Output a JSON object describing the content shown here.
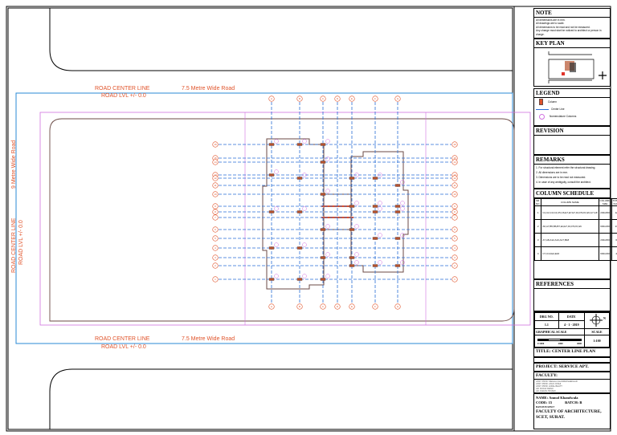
{
  "road": {
    "top_center_line": "ROAD CENTER LINE",
    "top_road_name": "7.5 Metre Wide Road",
    "top_level": "ROAD LVL +/- 0.0",
    "bottom_center_line": "ROAD CENTER LINE",
    "bottom_road_name": "7.5 Metre Wide Road",
    "bottom_level": "ROAD LVL +/- 0.0",
    "left_road_name": "9 Metre Wide Road",
    "left_center_line": "ROAD CENTER LINE",
    "left_level": "ROAD LVL +/- 0.0"
  },
  "grid": {
    "vertical_labels": [
      "A",
      "B",
      "C",
      "D",
      "E",
      "F",
      "G"
    ],
    "horizontal_labels": [
      "16",
      "15",
      "14",
      "13",
      "12",
      "11",
      "10",
      "9",
      "8",
      "7",
      "6",
      "5",
      "4",
      "3",
      "2",
      "1"
    ]
  },
  "colors": {
    "grid": "#2a6fd6",
    "bubble": "#e0532a",
    "column": "#b5522e",
    "wall": "#6b4a45",
    "magenta": "#d070e0",
    "road_line": "#2a8ad6"
  },
  "title_block": {
    "note_header": "NOTE",
    "notes": [
      "All dimensions are in mm.",
      "All drawings are to scale.",
      "All dimensions to be read and not be measured.",
      "Any change must start be noticed to architect or person in charge."
    ],
    "key_plan_header": "KEY PLAN",
    "legend_header": "LEGEND",
    "legend": [
      {
        "icon": "column-icon",
        "label": "Column"
      },
      {
        "icon": "center-line-icon",
        "label": "Center Line"
      },
      {
        "icon": "nomenclature-icon",
        "label": "Nomenclature Columns"
      }
    ],
    "revision_header": "REVISION",
    "remarks_header": "REMARKS",
    "remarks": [
      "1. For structural element refer the structural drawing.",
      "2. All dimensions are in mm.",
      "3. Dimensions are to be read not measured.",
      "4. In case of any ambiguity, consult the architect."
    ],
    "schedule_header": "COLUMN SCHEDULE",
    "schedule_columns": [
      "SR. NO.",
      "COLUMN NAME",
      "COLUMN SIZE",
      "TOTAL NUM.",
      "REMARK"
    ],
    "schedule_rows": [
      [
        "1",
        "C1,C2,C3,C4,C5,C6,E7,E7,E7,F4,F5,F6,G6,G7,G8",
        "230x450",
        "12",
        "--"
      ],
      [
        "2",
        "A6,A7,B5,B6,B7,E4,E7,F4,F5,F6,G6",
        "600x230",
        "13",
        "--"
      ],
      [
        "3",
        "A7,A8,A12,A13,A17,B18",
        "230x450",
        "6",
        "Both Columns"
      ],
      [
        "4",
        "C7,C13,E4,E16",
        "600x230",
        "4",
        "Both Columns"
      ]
    ],
    "references_header": "REFERENCES",
    "drg_no_label": "DRG NO.",
    "drg_no": "1.1",
    "date_label": "DATE",
    "date": "4 - 1 - 2019",
    "graphical_scale_label": "GRAPHICAL SCALE",
    "scale_ticks": [
      "0 1000",
      "2000",
      "4000"
    ],
    "scale_label": "SCALE",
    "scale": "1:100",
    "north": "N",
    "title": "TITLE: CENTER LINE PLAN",
    "project": "PROJECT: SERVICE APT.",
    "faculty_header": "FACULTY:",
    "faculty": [
      "ASST. PROF. MEGHA CHANDRASHEKHAR",
      "ASST. PROF. ANUJ JOSHI",
      "ASST. PROF. HIRAL BHATT",
      "AR. RUCHI DESAI",
      "AR. KARAN TRIVEDI",
      "AR. AMIT PATEL"
    ],
    "name": "NAME: Anmol Khandwala",
    "code": "CODE: 15",
    "batch": "BATCH: B",
    "batch_sub": "BATCH:B  SEM:7",
    "institute": "FACULTY OF ARCHITECTURE, SCET, SURAT."
  }
}
